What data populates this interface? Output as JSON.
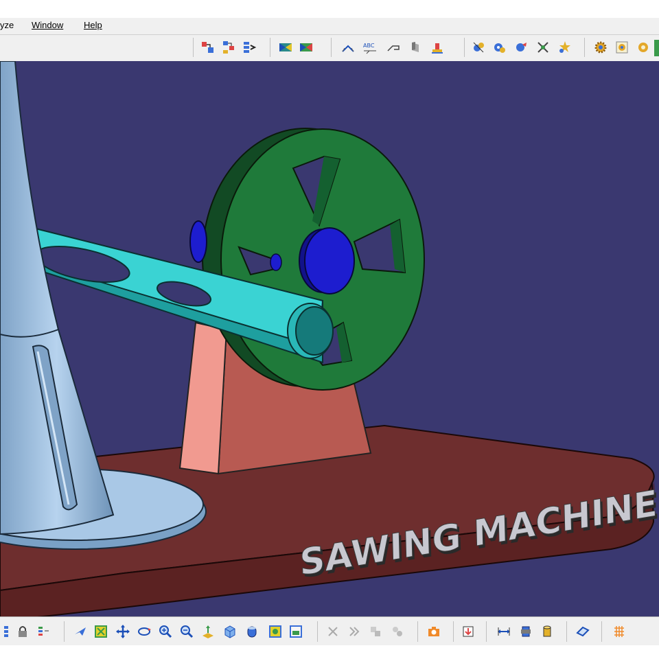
{
  "menu": {
    "items": [
      {
        "label": "yze"
      },
      {
        "label": "Window"
      },
      {
        "label": "Help"
      }
    ]
  },
  "viewport": {
    "background": "#3a3870",
    "model_label": "SAWING MACHINE",
    "colors": {
      "base": "#6e2e2e",
      "support": "#e8847c",
      "flywheel": "#1f7a3a",
      "pins": "#1d1dcf",
      "connecting_rod": "#3ad3d3",
      "column": "#9cbfe0"
    }
  },
  "top_toolbar": {
    "icons": [
      "assembly-icon",
      "constraint-icon",
      "tree-icon",
      "view-left-icon",
      "view-right-icon",
      "measure-icon",
      "abc-text-icon",
      "annotation-icon",
      "flag-icon",
      "stamp-icon",
      "compass-icon",
      "catalog-icon",
      "replace-icon",
      "snap-icon",
      "highlight-icon",
      "gear-settings-icon",
      "gear-product-icon",
      "gear-scene-icon"
    ]
  },
  "bottom_toolbar": {
    "icons": [
      "tree-expand-icon",
      "lock-icon",
      "list-icon",
      "fly-icon",
      "fit-all-icon",
      "pan-icon",
      "rotate-icon",
      "zoom-in-icon",
      "zoom-out-icon",
      "normal-view-icon",
      "iso-view-icon",
      "shading-icon",
      "cube-view-icon",
      "render-icon",
      "cut-icon",
      "skip-icon",
      "swap-icon",
      "multi-icon",
      "camera-icon",
      "import-icon",
      "dimension-icon",
      "bolt-icon",
      "cylinder-icon",
      "plane-icon",
      "grid-icon"
    ]
  }
}
